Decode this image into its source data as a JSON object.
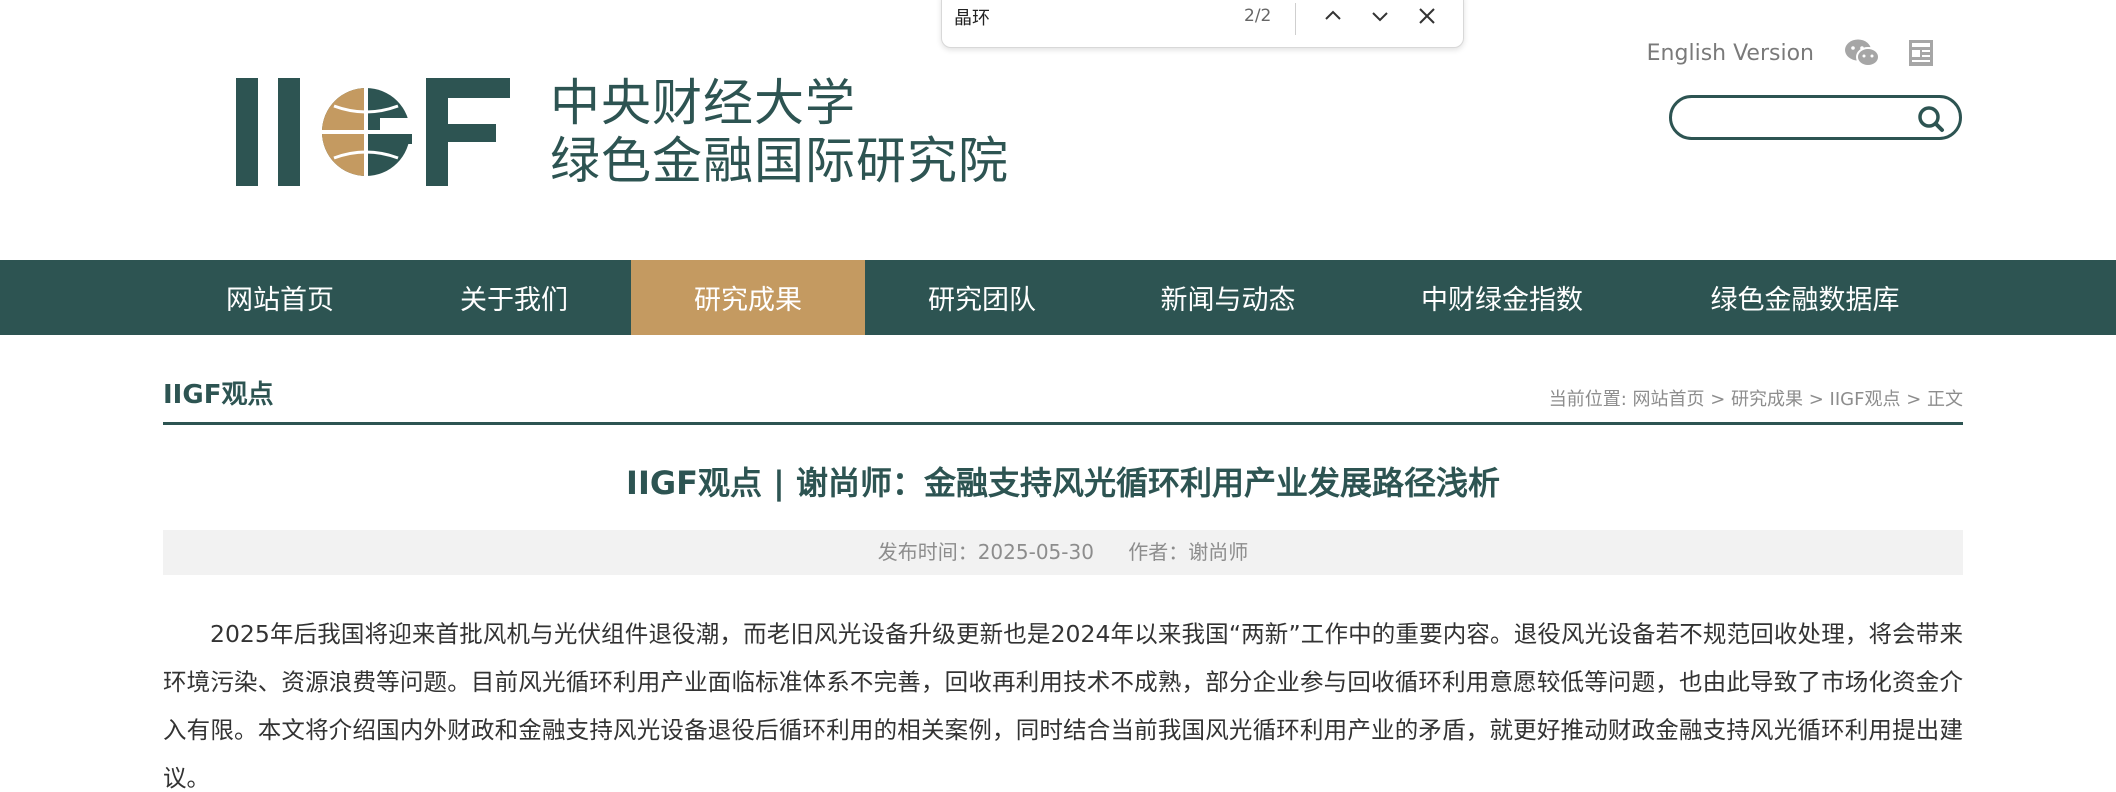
{
  "find_bar": {
    "query": "晶环",
    "count": "2/2"
  },
  "header": {
    "logo_text_line1": "中央财经大学",
    "logo_text_line2": "绿色金融国际研究院",
    "english_link": "English Version",
    "search_placeholder": ""
  },
  "colors": {
    "brand_green": "#2d5452",
    "accent_gold": "#c49a61"
  },
  "nav": {
    "items": [
      {
        "label": "网站首页"
      },
      {
        "label": "关于我们"
      },
      {
        "label": "研究成果"
      },
      {
        "label": "研究团队"
      },
      {
        "label": "新闻与动态"
      },
      {
        "label": "中财绿金指数"
      },
      {
        "label": "绿色金融数据库"
      }
    ]
  },
  "section": {
    "title": "IIGF观点",
    "breadcrumb": "当前位置: 网站首页 > 研究成果 > IIGF观点 > 正文"
  },
  "article": {
    "title": "IIGF观点 | 谢尚师：金融支持风光循环利用产业发展路径浅析",
    "publish_time": "发布时间：2025-05-30",
    "author": "作者：谢尚师",
    "paragraph": "2025年后我国将迎来首批风机与光伏组件退役潮，而老旧风光设备升级更新也是2024年以来我国“两新”工作中的重要内容。退役风光设备若不规范回收处理，将会带来环境污染、资源浪费等问题。目前风光循环利用产业面临标准体系不完善，回收再利用技术不成熟，部分企业参与回收循环利用意愿较低等问题，也由此导致了市场化资金介入有限。本文将介绍国内外财政和金融支持风光设备退役后循环利用的相关案例，同时结合当前我国风光循环利用产业的矛盾，就更好推动财政金融支持风光循环利用提出建议。"
  }
}
